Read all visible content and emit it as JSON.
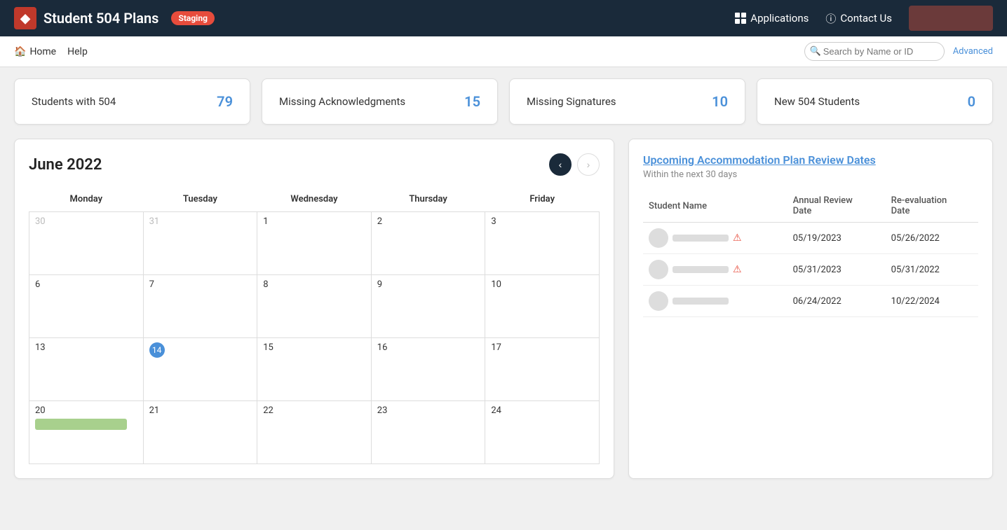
{
  "header": {
    "logo_label": "◆",
    "title": "Student 504 Plans",
    "staging_label": "Staging",
    "apps_label": "Applications",
    "contact_label": "Contact Us",
    "user_button_label": ""
  },
  "nav": {
    "home_label": "Home",
    "help_label": "Help",
    "search_placeholder": "Search by Name or ID",
    "advanced_label": "Advanced"
  },
  "stats": [
    {
      "label": "Students with 504",
      "value": "79"
    },
    {
      "label": "Missing Acknowledgments",
      "value": "15"
    },
    {
      "label": "Missing Signatures",
      "value": "10"
    },
    {
      "label": "New 504 Students",
      "value": "0"
    }
  ],
  "calendar": {
    "title": "June 2022",
    "days": [
      "Monday",
      "Tuesday",
      "Wednesday",
      "Thursday",
      "Friday"
    ],
    "weeks": [
      [
        {
          "num": "30",
          "prev": true,
          "today": false,
          "event": false
        },
        {
          "num": "31",
          "prev": true,
          "today": false,
          "event": false
        },
        {
          "num": "1",
          "prev": false,
          "today": false,
          "event": false
        },
        {
          "num": "2",
          "prev": false,
          "today": false,
          "event": false
        },
        {
          "num": "3",
          "prev": false,
          "today": false,
          "event": false
        }
      ],
      [
        {
          "num": "6",
          "prev": false,
          "today": false,
          "event": false
        },
        {
          "num": "7",
          "prev": false,
          "today": false,
          "event": false
        },
        {
          "num": "8",
          "prev": false,
          "today": false,
          "event": false
        },
        {
          "num": "9",
          "prev": false,
          "today": false,
          "event": false
        },
        {
          "num": "10",
          "prev": false,
          "today": false,
          "event": false
        }
      ],
      [
        {
          "num": "13",
          "prev": false,
          "today": false,
          "event": false
        },
        {
          "num": "14",
          "prev": false,
          "today": true,
          "event": false
        },
        {
          "num": "15",
          "prev": false,
          "today": false,
          "event": false
        },
        {
          "num": "16",
          "prev": false,
          "today": false,
          "event": false
        },
        {
          "num": "17",
          "prev": false,
          "today": false,
          "event": false
        }
      ],
      [
        {
          "num": "20",
          "prev": false,
          "today": false,
          "event": true
        },
        {
          "num": "21",
          "prev": false,
          "today": false,
          "event": false
        },
        {
          "num": "22",
          "prev": false,
          "today": false,
          "event": false
        },
        {
          "num": "23",
          "prev": false,
          "today": false,
          "event": false
        },
        {
          "num": "24",
          "prev": false,
          "today": false,
          "event": false
        }
      ]
    ]
  },
  "upcoming": {
    "title": "Upcoming Accommodation Plan Review Dates",
    "subtitle": "Within the next 30 days",
    "columns": {
      "name": "Student Name",
      "annual": "Annual Review Date",
      "reeval": "Re-evaluation Date"
    },
    "rows": [
      {
        "annual": "05/19/2023",
        "reeval": "05/26/2022",
        "warning": true
      },
      {
        "annual": "05/31/2023",
        "reeval": "05/31/2022",
        "warning": true
      },
      {
        "annual": "06/24/2022",
        "reeval": "10/22/2024",
        "warning": false
      }
    ]
  }
}
